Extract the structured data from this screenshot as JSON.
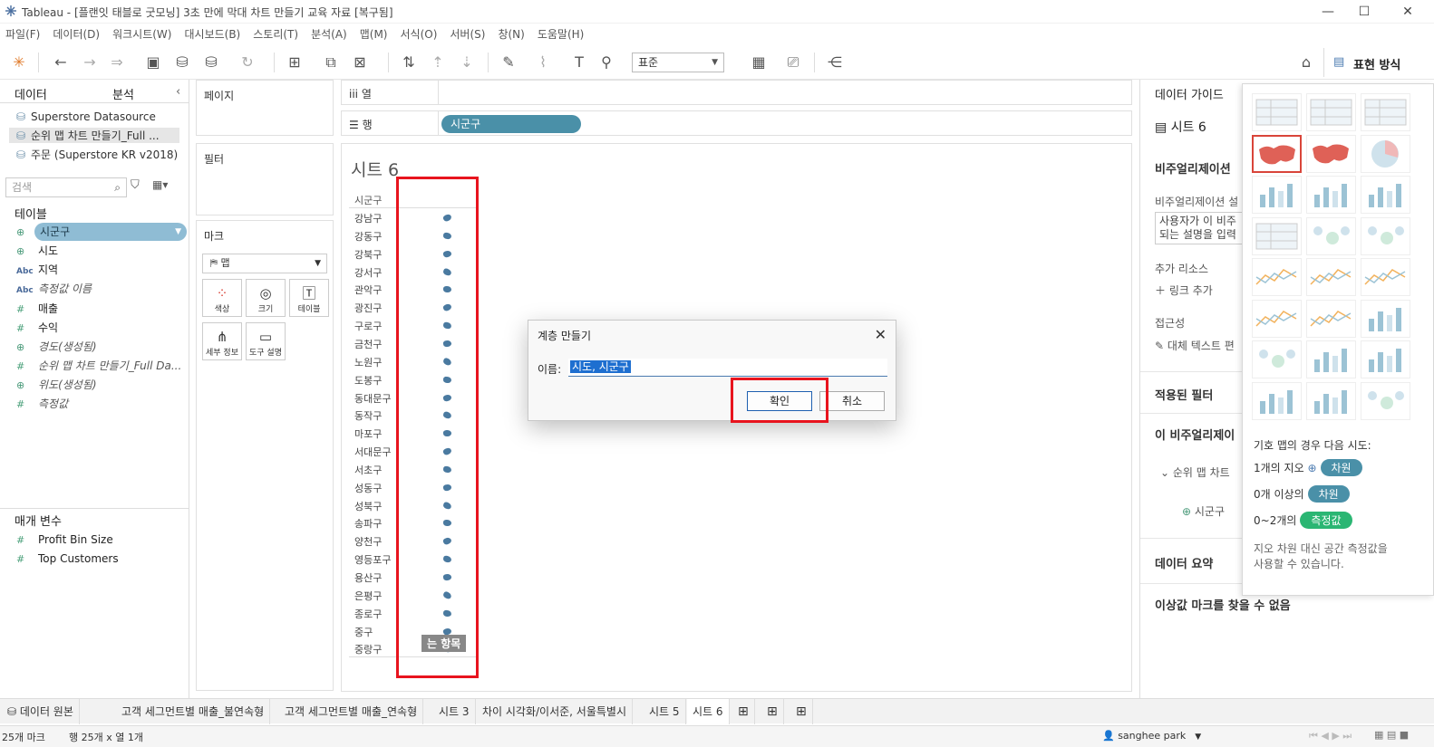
{
  "window": {
    "title": "Tableau - [플랜잇 태블로 굿모닝] 3초 만에 막대 차트 만들기 교육 자료 [복구됨]"
  },
  "menu": [
    "파일(F)",
    "데이터(D)",
    "워크시트(W)",
    "대시보드(B)",
    "스토리(T)",
    "분석(A)",
    "맵(M)",
    "서식(O)",
    "서버(S)",
    "창(N)",
    "도움말(H)"
  ],
  "toolbar": {
    "fit_select": "표준",
    "show_me_label": "표현 방식"
  },
  "left_panel": {
    "tab_data": "데이터",
    "tab_analysis": "분석",
    "datasources": [
      "Superstore Datasource",
      "순위 맵 차트 만들기_Full ...",
      "주문 (Superstore KR v2018)"
    ],
    "search_placeholder": "검색",
    "tables_header": "테이블",
    "fields": [
      {
        "icon": "geo",
        "name": "시군구"
      },
      {
        "icon": "geo",
        "name": "시도"
      },
      {
        "icon": "abc",
        "name": "지역"
      },
      {
        "icon": "abc",
        "name": "측정값 이름"
      },
      {
        "icon": "num",
        "name": "매출"
      },
      {
        "icon": "num",
        "name": "수익"
      },
      {
        "icon": "geo",
        "name": "경도(생성됨)"
      },
      {
        "icon": "num",
        "name": "순위 맵 차트 만들기_Full Da..."
      },
      {
        "icon": "geo",
        "name": "위도(생성됨)"
      },
      {
        "icon": "num",
        "name": "측정값"
      }
    ],
    "params_header": "매개 변수",
    "params": [
      "Profit Bin Size",
      "Top Customers"
    ]
  },
  "cards": {
    "pages": "페이지",
    "filters": "필터",
    "marks": "마크",
    "mark_type": "맵",
    "mark_buttons": [
      "색상",
      "크기",
      "테이블",
      "세부 정보",
      "도구 설명"
    ]
  },
  "shelves": {
    "columns_label": "열",
    "rows_label": "행",
    "rows_pill": "시군구"
  },
  "view": {
    "sheet_title": "시트 6",
    "column_header": "시군구",
    "rows": [
      "강남구",
      "강동구",
      "강북구",
      "강서구",
      "관악구",
      "광진구",
      "구로구",
      "금천구",
      "노원구",
      "도봉구",
      "동대문구",
      "동작구",
      "마포구",
      "서대문구",
      "서초구",
      "성동구",
      "성북구",
      "송파구",
      "양천구",
      "영등포구",
      "용산구",
      "은평구",
      "종로구",
      "중구",
      "중랑구"
    ],
    "drag_tag": "는 항목"
  },
  "dialog": {
    "title": "계층 만들기",
    "name_label": "이름:",
    "name_value": "시도, 시군구",
    "ok": "확인",
    "cancel": "취소"
  },
  "right_panel": {
    "data_guide": "데이터 가이드",
    "sheet": "시트 6",
    "viz_header": "비주얼리제이션",
    "viz_desc_label": "비주얼리제이션 설",
    "viz_desc_line1": "사용자가 이 비주",
    "viz_desc_line2": "되는 설명을 입력",
    "resources": "추가 리소스",
    "add_link": "링크 추가",
    "accessibility": "접근성",
    "alt_text": "대체 텍스트 편",
    "applied_filters": "적용된 필터",
    "this_viz": "이 비주얼리제이",
    "ds_node": "순위 맵 차트",
    "field_node": "시군구",
    "data_summary": "데이터 요약",
    "outliers": "이상값 마크를 찾을 수 없음"
  },
  "show_me": {
    "note_title": "기호 맵의 경우 다음 시도:",
    "req1_text": "1개의 지오",
    "req1_badge": "차원",
    "req2_text": "0개 이상의",
    "req2_badge": "차원",
    "req3_text": "0~2개의",
    "req3_badge": "측정값",
    "hint_line1": "지오 차원 대신 공간 측정값을",
    "hint_line2": "사용할 수 있습니다."
  },
  "tabs": [
    "데이터 원본",
    "고객 세그먼트별 매출_불연속형",
    "고객 세그먼트별 매출_연속형",
    "시트 3",
    "차이 시각화/이서준, 서울특별시",
    "시트 5",
    "시트 6"
  ],
  "status": {
    "marks": "25개 마크",
    "rows_cols": "행 25개 x 열 1개",
    "user": "sanghee park"
  },
  "colors": {
    "accent": "#4a90a8",
    "red_highlight": "#e8141e",
    "dim_badge": "#4a90a8",
    "measure_badge": "#2bb673"
  }
}
